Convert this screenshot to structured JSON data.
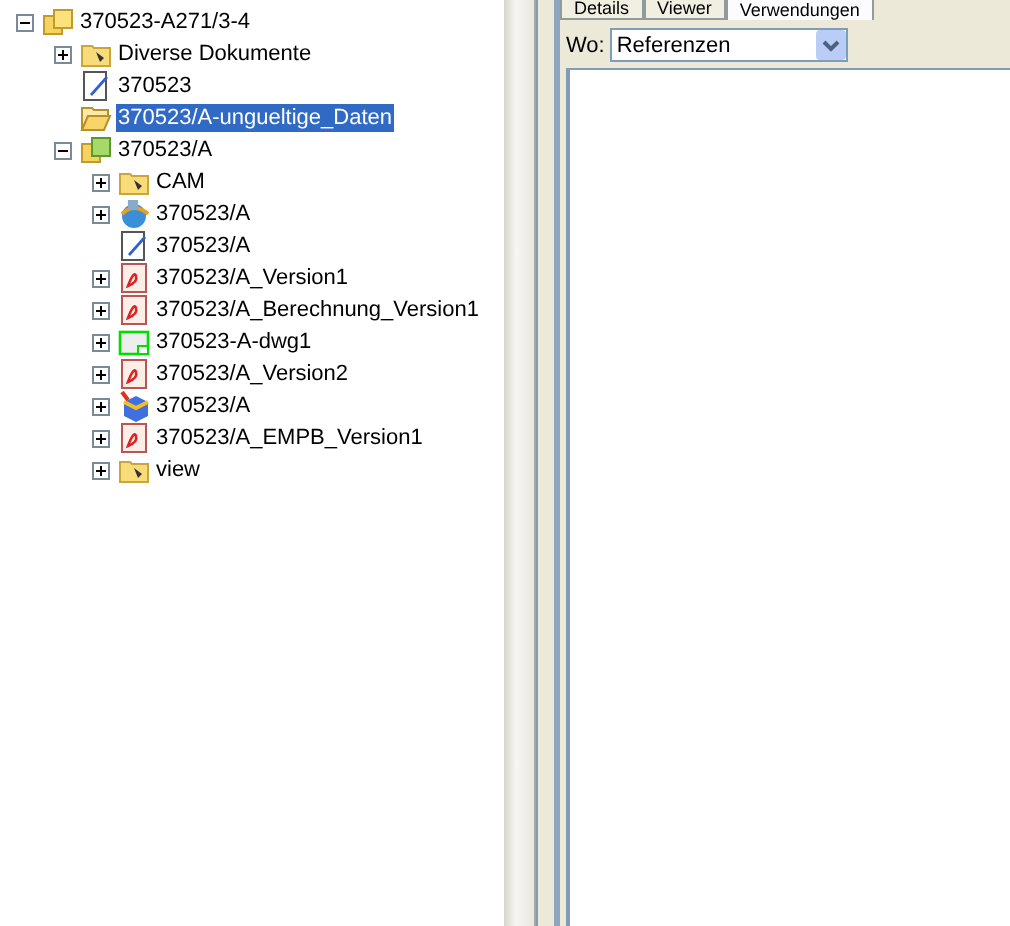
{
  "tree": [
    {
      "label": "370523-A271/3-4",
      "kind": "project",
      "expanded": true,
      "selected": false,
      "children": [
        {
          "label": "Diverse Dokumente",
          "kind": "folder",
          "expanded": false,
          "selected": false
        },
        {
          "label": "370523",
          "kind": "document",
          "selected": false
        },
        {
          "label": "370523/A-ungueltige_Daten",
          "kind": "open-folder",
          "selected": true
        },
        {
          "label": "370523/A",
          "kind": "assembly",
          "expanded": true,
          "selected": false,
          "children": [
            {
              "label": "CAM",
              "kind": "folder",
              "expanded": false,
              "selected": false
            },
            {
              "label": "370523/A",
              "kind": "globe",
              "expanded": false,
              "selected": false
            },
            {
              "label": "370523/A",
              "kind": "document",
              "selected": false
            },
            {
              "label": "370523/A_Version1",
              "kind": "pdf",
              "expanded": false,
              "selected": false
            },
            {
              "label": "370523/A_Berechnung_Version1",
              "kind": "pdf",
              "expanded": false,
              "selected": false
            },
            {
              "label": "370523-A-dwg1",
              "kind": "drawing",
              "expanded": false,
              "selected": false
            },
            {
              "label": "370523/A_Version2",
              "kind": "pdf",
              "expanded": false,
              "selected": false
            },
            {
              "label": "370523/A",
              "kind": "cube",
              "expanded": false,
              "selected": false
            },
            {
              "label": "370523/A_EMPB_Version1",
              "kind": "pdf",
              "expanded": false,
              "selected": false
            },
            {
              "label": "view",
              "kind": "folder",
              "expanded": false,
              "selected": false
            }
          ]
        }
      ]
    }
  ],
  "tabs": [
    {
      "label": "Details",
      "selected": false
    },
    {
      "label": "Viewer",
      "selected": false
    },
    {
      "label": "Verwendungen",
      "selected": true
    }
  ],
  "filter": {
    "label": "Wo:",
    "value": "Referenzen"
  }
}
